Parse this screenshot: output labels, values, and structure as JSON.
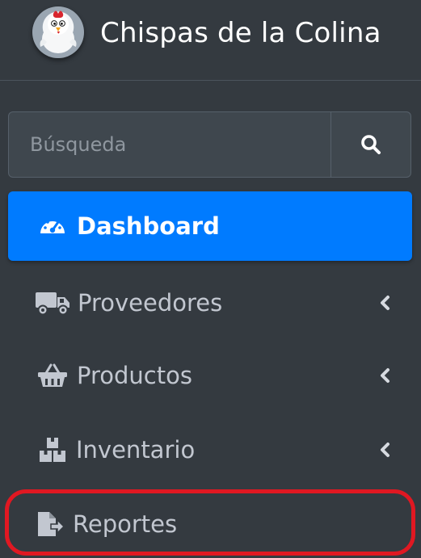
{
  "brand": {
    "logo_icon": "chicken-mascot-icon",
    "title": "Chispas de la Colina"
  },
  "search": {
    "placeholder": "Búsqueda",
    "value": "",
    "button_icon": "search-icon"
  },
  "nav": {
    "items": [
      {
        "label": "Dashboard",
        "icon": "tachometer-icon",
        "active": true,
        "has_submenu": false
      },
      {
        "label": "Proveedores",
        "icon": "truck-icon",
        "active": false,
        "has_submenu": true
      },
      {
        "label": "Productos",
        "icon": "shopping-basket-icon",
        "active": false,
        "has_submenu": true
      },
      {
        "label": "Inventario",
        "icon": "boxes-icon",
        "active": false,
        "has_submenu": true
      },
      {
        "label": "Reportes",
        "icon": "file-export-icon",
        "active": false,
        "has_submenu": false,
        "annotated": true
      }
    ]
  },
  "colors": {
    "sidebar_bg": "#343a40",
    "active_bg": "#007bff",
    "text": "#c2c7d0",
    "annotation": "#e01822"
  }
}
